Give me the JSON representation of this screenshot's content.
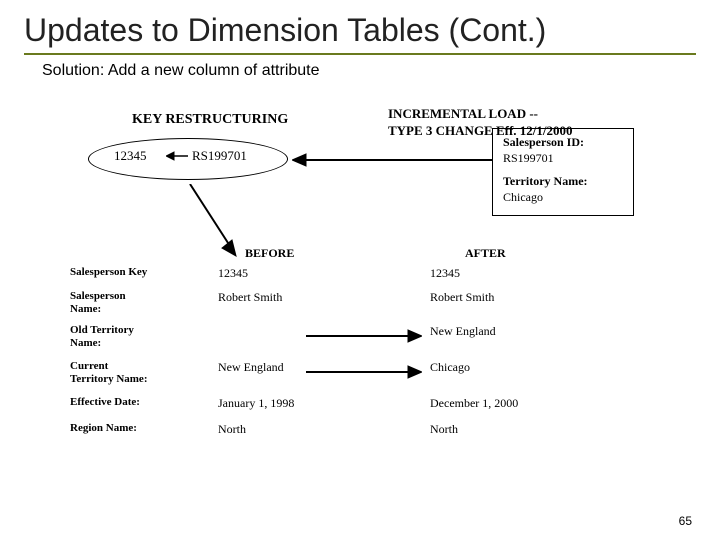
{
  "title": "Updates to Dimension Tables (Cont.)",
  "solution": "Solution: Add a new column of attribute",
  "diagram": {
    "keyRestructuringLabel": "KEY RESTRUCTURING",
    "incrementalLoadLine1": "INCREMENTAL LOAD --",
    "incrementalLoadLine2": "TYPE 3 CHANGE Eff. 12/1/2000",
    "ellipseLeft": "12345",
    "ellipseRight": "RS199701",
    "box": {
      "spIdLabel": "Salesperson ID:",
      "spIdValue": "RS199701",
      "terrLabel": "Territory Name:",
      "terrValue": "Chicago"
    },
    "headBefore": "BEFORE",
    "headAfter": "AFTER",
    "rows": [
      {
        "label": "Salesperson Key",
        "before": "12345",
        "after": "12345"
      },
      {
        "label": "Salesperson\nName:",
        "before": "Robert Smith",
        "after": "Robert Smith"
      },
      {
        "label": "Old Territory\nName:",
        "before": "",
        "after": "New England"
      },
      {
        "label": "Current\nTerritory Name:",
        "before": "New England",
        "after": "Chicago"
      },
      {
        "label": "Effective Date:",
        "before": "January 1, 1998",
        "after": "December 1, 2000"
      },
      {
        "label": "Region Name:",
        "before": "North",
        "after": "North"
      }
    ]
  },
  "pageNumber": "65"
}
